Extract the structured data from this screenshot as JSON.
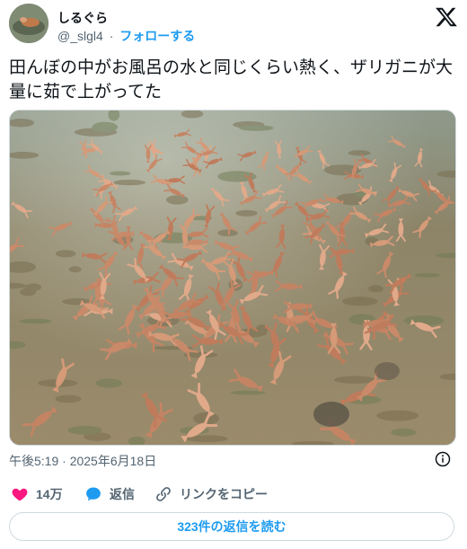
{
  "author": {
    "display_name": "しるぐら",
    "handle": "@_slgl4",
    "separator": "·",
    "follow_label": "フォローする"
  },
  "tweet": {
    "text": "田んぼの中がお風呂の水と同じくらい熱く、ザリガニが大量に茹で上がってた",
    "timestamp": "午後5:19 · 2025年6月18日"
  },
  "actions": {
    "like_count": "14万",
    "reply_label": "返信",
    "copy_link_label": "リンクをコピー"
  },
  "read_replies_label": "323件の返信を読む",
  "colors": {
    "accent": "#1d9bf0",
    "like": "#f91880",
    "muted": "#536471"
  },
  "icons": {
    "logo": "x-logo-icon",
    "info": "info-icon",
    "like": "heart-icon",
    "reply": "speech-bubble-icon",
    "copy": "link-icon"
  }
}
